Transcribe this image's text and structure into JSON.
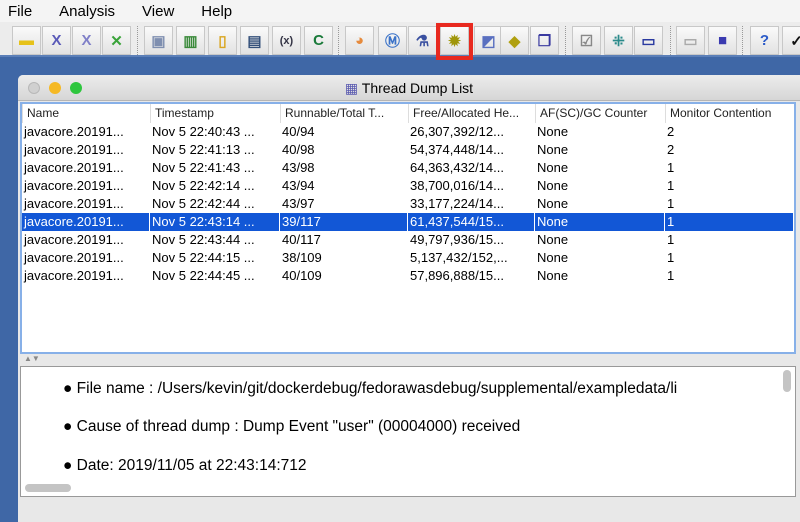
{
  "menu": [
    "File",
    "Analysis",
    "View",
    "Help"
  ],
  "toolbar": {
    "buttons": [
      {
        "icon": "open-folder-icon",
        "glyph": "▬",
        "color": "#e6c21a"
      },
      {
        "icon": "close-x-icon",
        "glyph": "X",
        "color": "#5a5ab8"
      },
      {
        "icon": "close-all-x-icon",
        "glyph": "X",
        "color": "#8080c8"
      },
      {
        "icon": "green-x-icon",
        "glyph": "✕",
        "color": "#39a339"
      },
      {
        "icon": "cpu-icon",
        "glyph": "▣",
        "color": "#7f8fb0"
      },
      {
        "icon": "memory-icon",
        "glyph": "▥",
        "color": "#3a8a3a"
      },
      {
        "icon": "container-icon",
        "glyph": "▯",
        "color": "#d9a520"
      },
      {
        "icon": "window-list-icon",
        "glyph": "▤",
        "color": "#34507a"
      },
      {
        "icon": "variable-icon",
        "glyph": "(x)",
        "color": "#334"
      },
      {
        "icon": "class-icon",
        "glyph": "C",
        "color": "#1a7a3a"
      },
      {
        "icon": "pie-chart-icon",
        "glyph": "◕",
        "color": "#e68a3c"
      },
      {
        "icon": "monitor-m-icon",
        "glyph": "Ⓜ",
        "color": "#3a72c8"
      },
      {
        "icon": "microscope-icon",
        "glyph": "⚗",
        "color": "#3a50a0"
      },
      {
        "icon": "gear-icon",
        "glyph": "✹",
        "color": "#a0960a"
      },
      {
        "icon": "screen-compare-icon",
        "glyph": "◩",
        "color": "#5a70c0"
      },
      {
        "icon": "tag-icon",
        "glyph": "◆",
        "color": "#b0a010"
      },
      {
        "icon": "windows-icon",
        "glyph": "❐",
        "color": "#3a3aa0"
      },
      {
        "icon": "checklist-icon",
        "glyph": "☑",
        "color": "#888"
      },
      {
        "icon": "grid-icon",
        "glyph": "⁜",
        "color": "#2a8a8a"
      },
      {
        "icon": "display-icon",
        "glyph": "▭",
        "color": "#2a3aa0"
      },
      {
        "icon": "bar-icon",
        "glyph": "▭",
        "color": "#aaa"
      },
      {
        "icon": "monitor-icon",
        "glyph": "■",
        "color": "#3a3ab0"
      },
      {
        "icon": "help-icon",
        "glyph": "?",
        "color": "#2a5ac8"
      },
      {
        "icon": "check-icon",
        "glyph": "✓",
        "color": "#111"
      }
    ]
  },
  "window": {
    "title": "Thread Dump List"
  },
  "table": {
    "columns": [
      "Name",
      "Timestamp",
      "Runnable/Total T...",
      "Free/Allocated He...",
      "AF(SC)/GC Counter",
      "Monitor Contention"
    ],
    "rows": [
      [
        "javacore.20191...",
        "Nov 5 22:40:43 ...",
        "40/94",
        "26,307,392/12...",
        "None",
        "2"
      ],
      [
        "javacore.20191...",
        "Nov 5 22:41:13 ...",
        "40/98",
        "54,374,448/14...",
        "None",
        "2"
      ],
      [
        "javacore.20191...",
        "Nov 5 22:41:43 ...",
        "43/98",
        "64,363,432/14...",
        "None",
        "1"
      ],
      [
        "javacore.20191...",
        "Nov 5 22:42:14 ...",
        "43/94",
        "38,700,016/14...",
        "None",
        "1"
      ],
      [
        "javacore.20191...",
        "Nov 5 22:42:44 ...",
        "43/97",
        "33,177,224/14...",
        "None",
        "1"
      ],
      [
        "javacore.20191...",
        "Nov 5 22:43:14 ...",
        "39/117",
        "61,437,544/15...",
        "None",
        "1"
      ],
      [
        "javacore.20191...",
        "Nov 5 22:43:44 ...",
        "40/117",
        "49,797,936/15...",
        "None",
        "1"
      ],
      [
        "javacore.20191...",
        "Nov 5 22:44:15 ...",
        "38/109",
        "5,137,432/152,...",
        "None",
        "1"
      ],
      [
        "javacore.20191...",
        "Nov 5 22:44:45 ...",
        "40/109",
        "57,896,888/15...",
        "None",
        "1"
      ]
    ],
    "selected_row": 5
  },
  "details": [
    "File name : /Users/kevin/git/dockerdebug/fedorawasdebug/supplemental/exampledata/li",
    "Cause of thread dump : Dump Event \"user\" (00004000) received",
    "Date: 2019/11/05 at 22:43:14:712"
  ]
}
